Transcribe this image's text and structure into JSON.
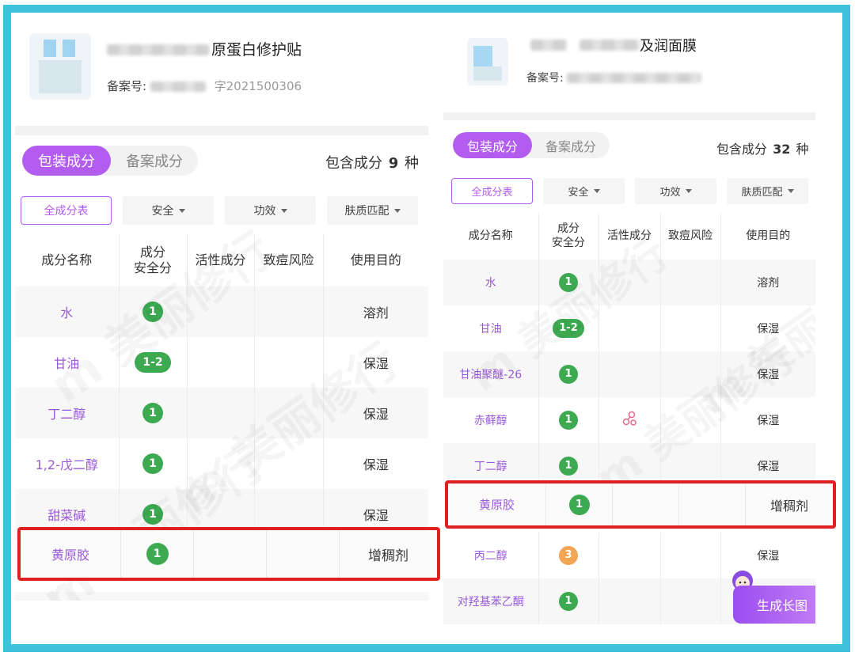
{
  "left": {
    "product": {
      "name": "原蛋白修护贴",
      "reg_label": "备案号:",
      "reg_number": "字2021500306"
    },
    "tabs": [
      "包装成分",
      "备案成分"
    ],
    "count": {
      "prefix": "包含成分",
      "value": "9",
      "suffix": "种"
    },
    "filters": {
      "all": "全成分表",
      "safety": "安全",
      "effect": "功效",
      "skin": "肤质匹配"
    },
    "headers": {
      "name": "成分名称",
      "score": "成分\n安全分",
      "active": "活性成分",
      "acne": "致痘风险",
      "purpose": "使用目的"
    },
    "rows": [
      {
        "name": "水",
        "score": "1",
        "purpose": "溶剂"
      },
      {
        "name": "甘油",
        "score": "1-2",
        "purpose": "保湿"
      },
      {
        "name": "丁二醇",
        "score": "1",
        "purpose": "保湿"
      },
      {
        "name": "1,2-戊二醇",
        "score": "1",
        "purpose": "保湿"
      },
      {
        "name": "甜菜碱",
        "score": "1",
        "purpose": "保湿"
      }
    ],
    "highlight": {
      "name": "黄原胶",
      "score": "1",
      "purpose": "增稠剂"
    }
  },
  "right": {
    "product": {
      "name": "及润面膜",
      "reg_label": "备案号:"
    },
    "tabs": [
      "包装成分",
      "备案成分"
    ],
    "count": {
      "prefix": "包含成分",
      "value": "32",
      "suffix": "种"
    },
    "filters": {
      "all": "全成分表",
      "safety": "安全",
      "effect": "功效",
      "skin": "肤质匹配"
    },
    "headers": {
      "name": "成分名称",
      "score": "成分\n安全分",
      "active": "活性成分",
      "acne": "致痘风险",
      "purpose": "使用目的"
    },
    "rows_top": [
      {
        "name": "水",
        "score": "1",
        "purpose": "溶剂"
      },
      {
        "name": "甘油",
        "score": "1-2",
        "purpose": "保湿"
      },
      {
        "name": "甘油聚醚-26",
        "score": "1",
        "purpose": "保湿"
      },
      {
        "name": "赤藓醇",
        "score": "1",
        "active": true,
        "purpose": "保湿"
      },
      {
        "name": "丁二醇",
        "score": "1",
        "purpose": "保湿"
      }
    ],
    "highlight": {
      "name": "黄原胶",
      "score": "1",
      "purpose": "增稠剂"
    },
    "rows_bottom": [
      {
        "name": "丙二醇",
        "score": "3",
        "orange": true,
        "purpose": "保湿"
      },
      {
        "name": "对羟基苯乙酮",
        "score": "1",
        "purpose": ""
      }
    ],
    "generate_button": "生成长图"
  },
  "colors": {
    "accent": "#b25cf0",
    "safe": "#3daa52",
    "warn": "#f2a553",
    "highlight": "#e02020",
    "frame": "#3ec3dc"
  }
}
